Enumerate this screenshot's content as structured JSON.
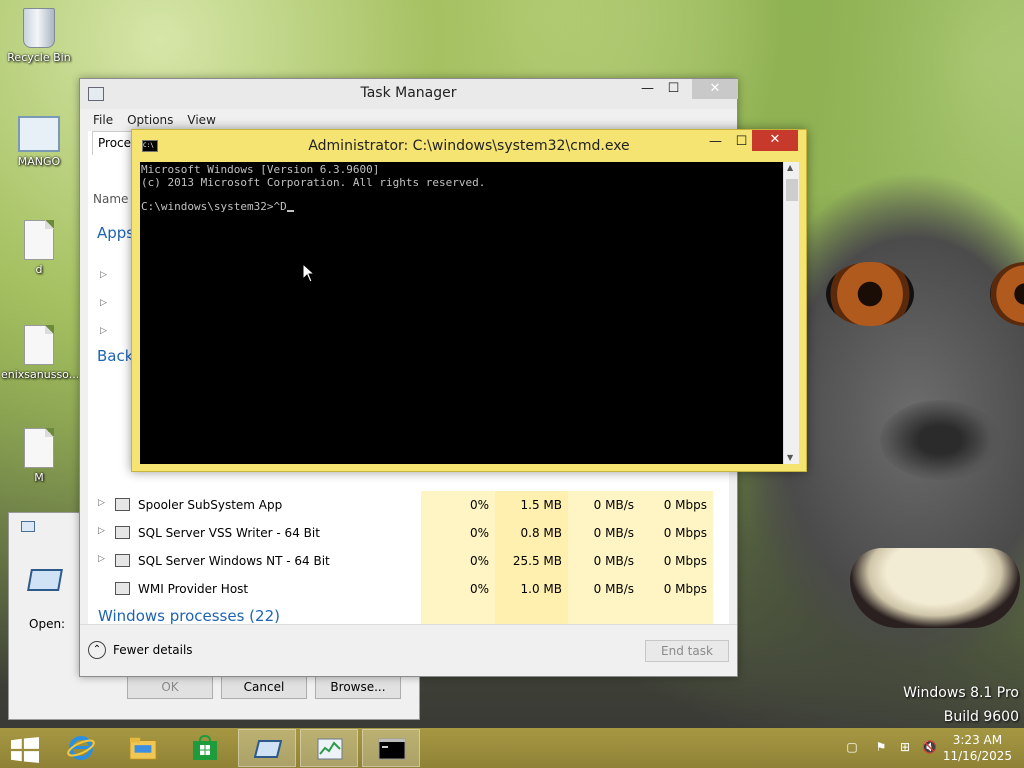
{
  "desktop": {
    "icons": [
      {
        "label": "Recycle Bin",
        "icon": "recycle-bin-icon"
      },
      {
        "label": "MANGO",
        "icon": "window-shortcut-icon"
      },
      {
        "label": "d",
        "icon": "text-document-icon"
      },
      {
        "label": "enixsanusso...",
        "icon": "text-document-icon"
      },
      {
        "label": "M",
        "icon": "text-document-icon"
      }
    ],
    "watermark": {
      "line1": "Windows 8.1 Pro",
      "line2": "Build 9600"
    }
  },
  "task_manager": {
    "title": "Task Manager",
    "menu": [
      "File",
      "Options",
      "View"
    ],
    "tab_processes": "Proces",
    "col_name": "Name",
    "section_apps": "Apps",
    "section_background": "Back",
    "section_windows": "Windows processes (22)",
    "rows": [
      {
        "name": "Spooler SubSystem App",
        "cpu": "0%",
        "memory": "1.5 MB",
        "disk": "0 MB/s",
        "network": "0 Mbps",
        "expandable": true
      },
      {
        "name": "SQL Server VSS Writer - 64 Bit",
        "cpu": "0%",
        "memory": "0.8 MB",
        "disk": "0 MB/s",
        "network": "0 Mbps",
        "expandable": true
      },
      {
        "name": "SQL Server Windows NT - 64 Bit",
        "cpu": "0%",
        "memory": "25.5 MB",
        "disk": "0 MB/s",
        "network": "0 Mbps",
        "expandable": true
      },
      {
        "name": "WMI Provider Host",
        "cpu": "0%",
        "memory": "1.0 MB",
        "disk": "0 MB/s",
        "network": "0 Mbps",
        "expandable": false
      }
    ],
    "fewer_details": "Fewer details",
    "end_task": "End task",
    "minimize": "—",
    "maximize": "☐",
    "close": "✕"
  },
  "run_dialog": {
    "open_label": "Open:",
    "ok": "OK",
    "cancel": "Cancel",
    "browse": "Browse..."
  },
  "cmd": {
    "title": "Administrator: C:\\windows\\system32\\cmd.exe",
    "icon_text": "C:\\",
    "line1": "Microsoft Windows [Version 6.3.9600]",
    "line2": "(c) 2013 Microsoft Corporation. All rights reserved.",
    "prompt": "C:\\windows\\system32>^D",
    "minimize": "—",
    "maximize": "☐",
    "close": "✕"
  },
  "taskbar": {
    "apps": [
      "start-icon",
      "internet-explorer-icon",
      "file-explorer-icon",
      "store-icon",
      "run-dialog-icon",
      "task-manager-icon",
      "cmd-icon"
    ],
    "time": "3:23 AM",
    "date": "11/16/2025"
  }
}
